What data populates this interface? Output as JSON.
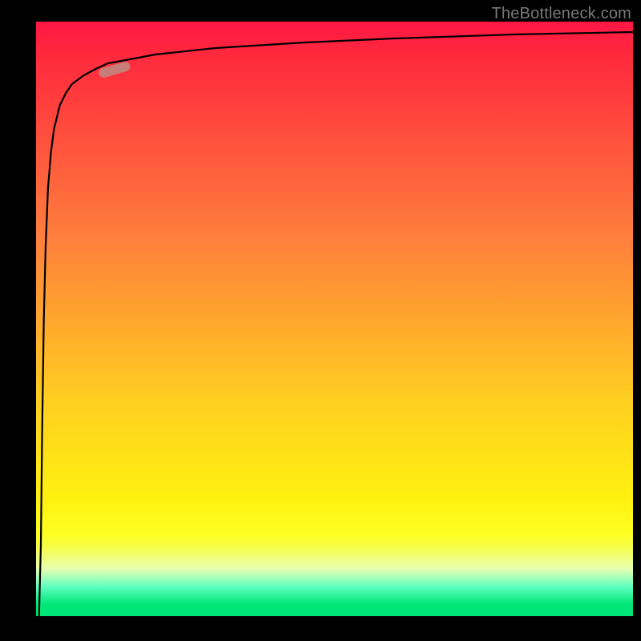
{
  "attribution": "TheBottleneck.com",
  "colors": {
    "gradient_top": "#ff1744",
    "gradient_bottom": "#00e676",
    "curve": "#000000",
    "marker": "#c97d78",
    "frame": "#000000",
    "attribution_text": "#777777"
  },
  "chart_data": {
    "type": "line",
    "title": "",
    "xlabel": "",
    "ylabel": "",
    "xlim": [
      0,
      100
    ],
    "ylim": [
      0,
      100
    ],
    "series": [
      {
        "name": "curve",
        "x": [
          0.5,
          0.8,
          1.0,
          1.3,
          1.6,
          2.0,
          2.5,
          3.0,
          3.5,
          4.0,
          5.0,
          6.0,
          8.0,
          10.0,
          12.0,
          15.0,
          20.0,
          30.0,
          45.0,
          60.0,
          80.0,
          100.0
        ],
        "y": [
          0.0,
          12.0,
          30.0,
          50.0,
          62.0,
          72.0,
          78.0,
          82.0,
          84.0,
          86.0,
          88.0,
          89.5,
          91.0,
          92.0,
          93.0,
          93.5,
          94.5,
          95.5,
          96.5,
          97.2,
          97.8,
          98.3
        ]
      }
    ],
    "marker": {
      "x": 13.0,
      "y": 91.5
    },
    "background_gradient": {
      "orientation": "vertical",
      "stops": [
        {
          "pos": 0.0,
          "color": "#ff1744"
        },
        {
          "pos": 0.3,
          "color": "#ff6d3d"
        },
        {
          "pos": 0.56,
          "color": "#ffb828"
        },
        {
          "pos": 0.8,
          "color": "#fff010"
        },
        {
          "pos": 0.92,
          "color": "#e8ffb0"
        },
        {
          "pos": 1.0,
          "color": "#00e676"
        }
      ]
    }
  }
}
